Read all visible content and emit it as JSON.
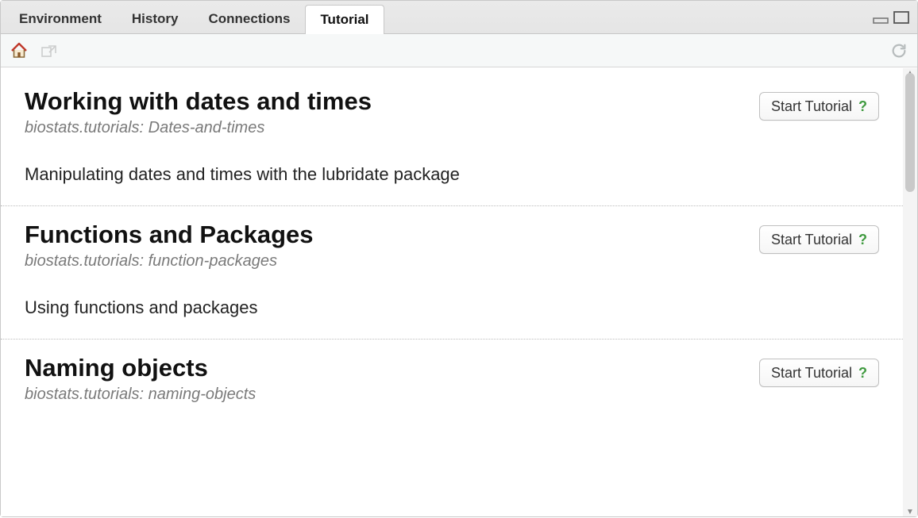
{
  "tabs": {
    "items": [
      {
        "label": "Environment",
        "active": false
      },
      {
        "label": "History",
        "active": false
      },
      {
        "label": "Connections",
        "active": false
      },
      {
        "label": "Tutorial",
        "active": true
      }
    ]
  },
  "toolbar": {
    "home_icon": "home-icon",
    "popout_icon": "popout-icon",
    "refresh_icon": "refresh-icon"
  },
  "start_button_label": "Start Tutorial",
  "help_glyph": "?",
  "tutorials": [
    {
      "title": "Working with dates and times",
      "subtitle": "biostats.tutorials: Dates-and-times",
      "description": "Manipulating dates and times with the lubridate package"
    },
    {
      "title": "Functions and Packages",
      "subtitle": "biostats.tutorials: function-packages",
      "description": "Using functions and packages"
    },
    {
      "title": "Naming objects",
      "subtitle": "biostats.tutorials: naming-objects",
      "description": ""
    }
  ]
}
